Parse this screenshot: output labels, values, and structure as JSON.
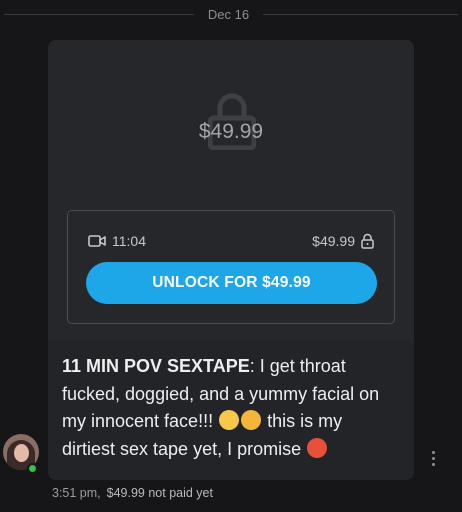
{
  "divider": {
    "date": "Dec 16"
  },
  "message": {
    "locked_price": "$49.99",
    "media": {
      "icon": "video-camera-icon",
      "duration": "11:04",
      "price": "$49.99",
      "lock_icon": "lock-icon"
    },
    "unlock_button": "UNLOCK FOR $49.99",
    "caption": {
      "bold": "11 MIN POV SEXTAPE",
      "line1_rest": ": I get throat",
      "line2": "fucked, doggied, and a yummy facial on",
      "line3": "my innocent face!!!",
      "line3_after": " this is my",
      "line4": "dirtiest sex tape yet, I promise",
      "emoji": [
        "pleading-face-emoji",
        "shushing-face-emoji",
        "hot-face-emoji"
      ]
    },
    "time": "3:51 pm,",
    "price_status": "$49.99 not paid yet"
  },
  "colors": {
    "background": "#161618",
    "bubble": "#222428",
    "accent": "#1da6e8",
    "online": "#35c14b"
  }
}
